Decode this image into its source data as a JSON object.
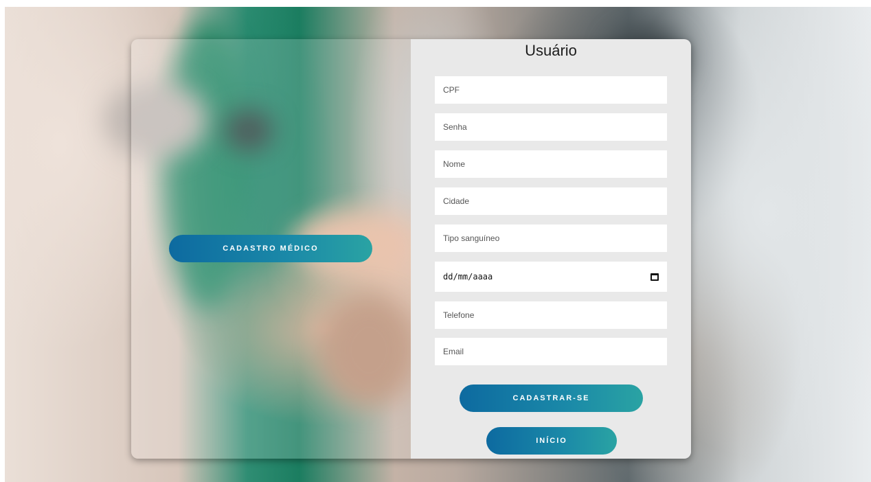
{
  "form": {
    "title": "Usuário",
    "fields": [
      {
        "placeholder": "CPF"
      },
      {
        "placeholder": "Senha"
      },
      {
        "placeholder": "Nome"
      },
      {
        "placeholder": "Cidade"
      },
      {
        "placeholder": "Tipo sanguíneo"
      },
      {
        "placeholder": "dd/mm/aaaa"
      },
      {
        "placeholder": "Telefone"
      },
      {
        "placeholder": "Email"
      }
    ],
    "date_icon": "calendar-icon",
    "submit_label": "CADASTRAR-SE",
    "home_label": "INÍCIO"
  },
  "side": {
    "doctor_button_label": "CADASTRO MÉDICO"
  },
  "colors": {
    "button_start": "#0d6aa0",
    "button_end": "#2aa3a3",
    "panel_bg": "#e9e9e9"
  }
}
